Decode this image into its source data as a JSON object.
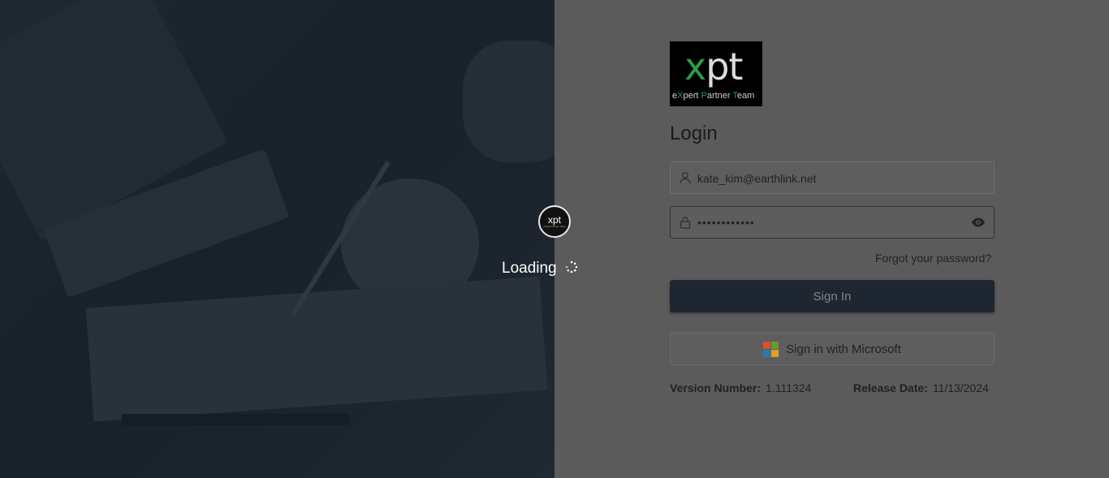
{
  "loader": {
    "logo_text": "xpt",
    "logo_subtext": "eXpert Partner Team",
    "text": "Loading"
  },
  "brand": {
    "logo_x": "x",
    "logo_pt": "pt",
    "tagline_e": "e",
    "tagline_X": "X",
    "tagline_pert": "pert ",
    "tagline_P": "P",
    "tagline_artner": "artner ",
    "tagline_T": "T",
    "tagline_eam": "eam",
    "accent_color": "#2e9b4a"
  },
  "login": {
    "title": "Login",
    "email_value": "kate_kim@earthlink.net",
    "password_value": "••••••••••••",
    "forgot_label": "Forgot your password?",
    "signin_label": "Sign In",
    "microsoft_label": "Sign in with Microsoft"
  },
  "footer": {
    "version_label": "Version Number:",
    "version_value": "1.111324",
    "release_label": "Release Date:",
    "release_value": "11/13/2024"
  },
  "icons": {
    "email": "user-icon",
    "password": "lock-icon",
    "reveal": "eye-icon",
    "microsoft": "microsoft-logo-icon"
  }
}
